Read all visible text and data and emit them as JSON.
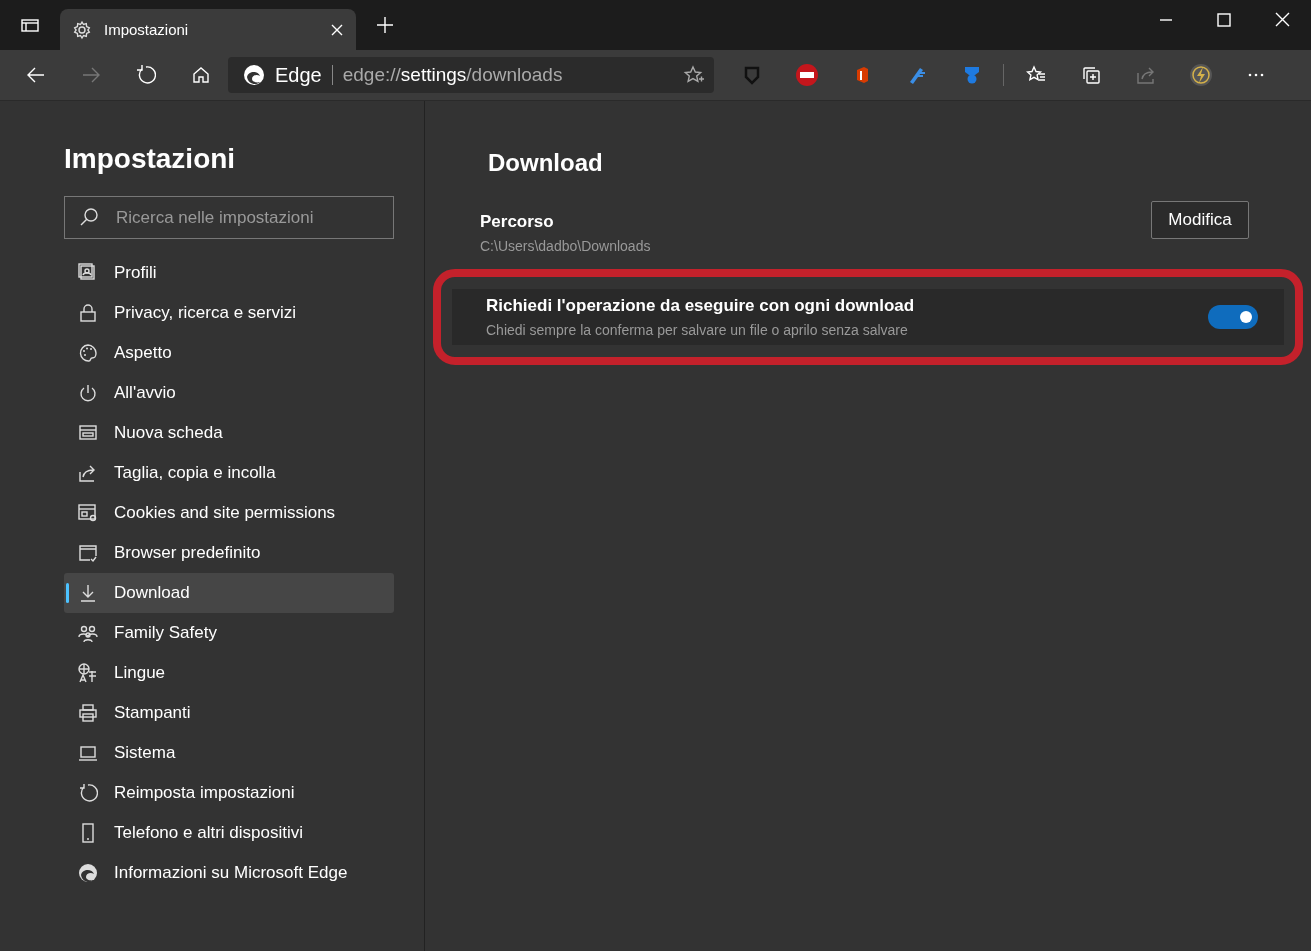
{
  "tabs": [
    {
      "label": "Impostazioni",
      "selected": true
    }
  ],
  "address_bar": {
    "site": "Edge",
    "url": "edge://**settings**/downloads"
  },
  "sidebar": {
    "title": "Impostazioni",
    "search": {
      "placeholder": "Ricerca nelle impostazioni"
    },
    "items": [
      {
        "label": "Profili",
        "selected": false
      },
      {
        "label": "Privacy, ricerca e servizi",
        "selected": false
      },
      {
        "label": "Aspetto",
        "selected": false
      },
      {
        "label": "All'avvio",
        "selected": false
      },
      {
        "label": "Nuova scheda",
        "selected": false
      },
      {
        "label": "Taglia, copia e incolla",
        "selected": false
      },
      {
        "label": "Cookies and site permissions",
        "selected": false
      },
      {
        "label": "Browser predefinito",
        "selected": false
      },
      {
        "label": "Download",
        "selected": true
      },
      {
        "label": "Family Safety",
        "selected": false
      },
      {
        "label": "Lingue",
        "selected": false
      },
      {
        "label": "Stampanti",
        "selected": false
      },
      {
        "label": "Sistema",
        "selected": false
      },
      {
        "label": "Reimposta impostazioni",
        "selected": false
      },
      {
        "label": "Telefono e altri dispositivi",
        "selected": false
      },
      {
        "label": "Informazioni su Microsoft Edge",
        "selected": false
      }
    ]
  },
  "content": {
    "title": "Download",
    "settings": [
      {
        "kind": "button",
        "label": "Percorso",
        "description": "C:\\Users\\dadbo\\Downloads",
        "button": "Modifica",
        "highlighted": false
      },
      {
        "kind": "toggle",
        "label": "Richiedi l'operazione da eseguire con ogni download",
        "description": "Chiedi sempre la conferma per salvare un file o aprilo senza salvare",
        "on": true,
        "highlighted": true
      }
    ]
  }
}
